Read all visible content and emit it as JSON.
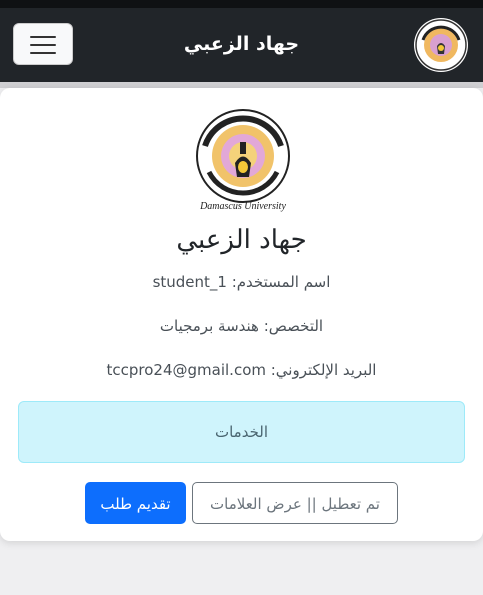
{
  "navbar": {
    "brand": "جهاد الزعبي",
    "menu_icon": "hamburger-menu-icon",
    "logo_icon": "damascus-university-logo"
  },
  "profile": {
    "logo_text": "Damascus University",
    "name": "جهاد الزعبي",
    "username_line": "اسم المستخدم: student_1",
    "specialty_line": "التخصص: هندسة برمجيات",
    "email_line": "البريد الإلكتروني: tccpro24@gmail.com"
  },
  "services": {
    "label": "الخدمات"
  },
  "actions": {
    "submit_request": "تقديم طلب",
    "view_grades": "تم تعطيل || عرض العلامات"
  },
  "colors": {
    "navbar": "#212529",
    "primary": "#0d6efd",
    "alert_bg": "#cff4fc"
  }
}
